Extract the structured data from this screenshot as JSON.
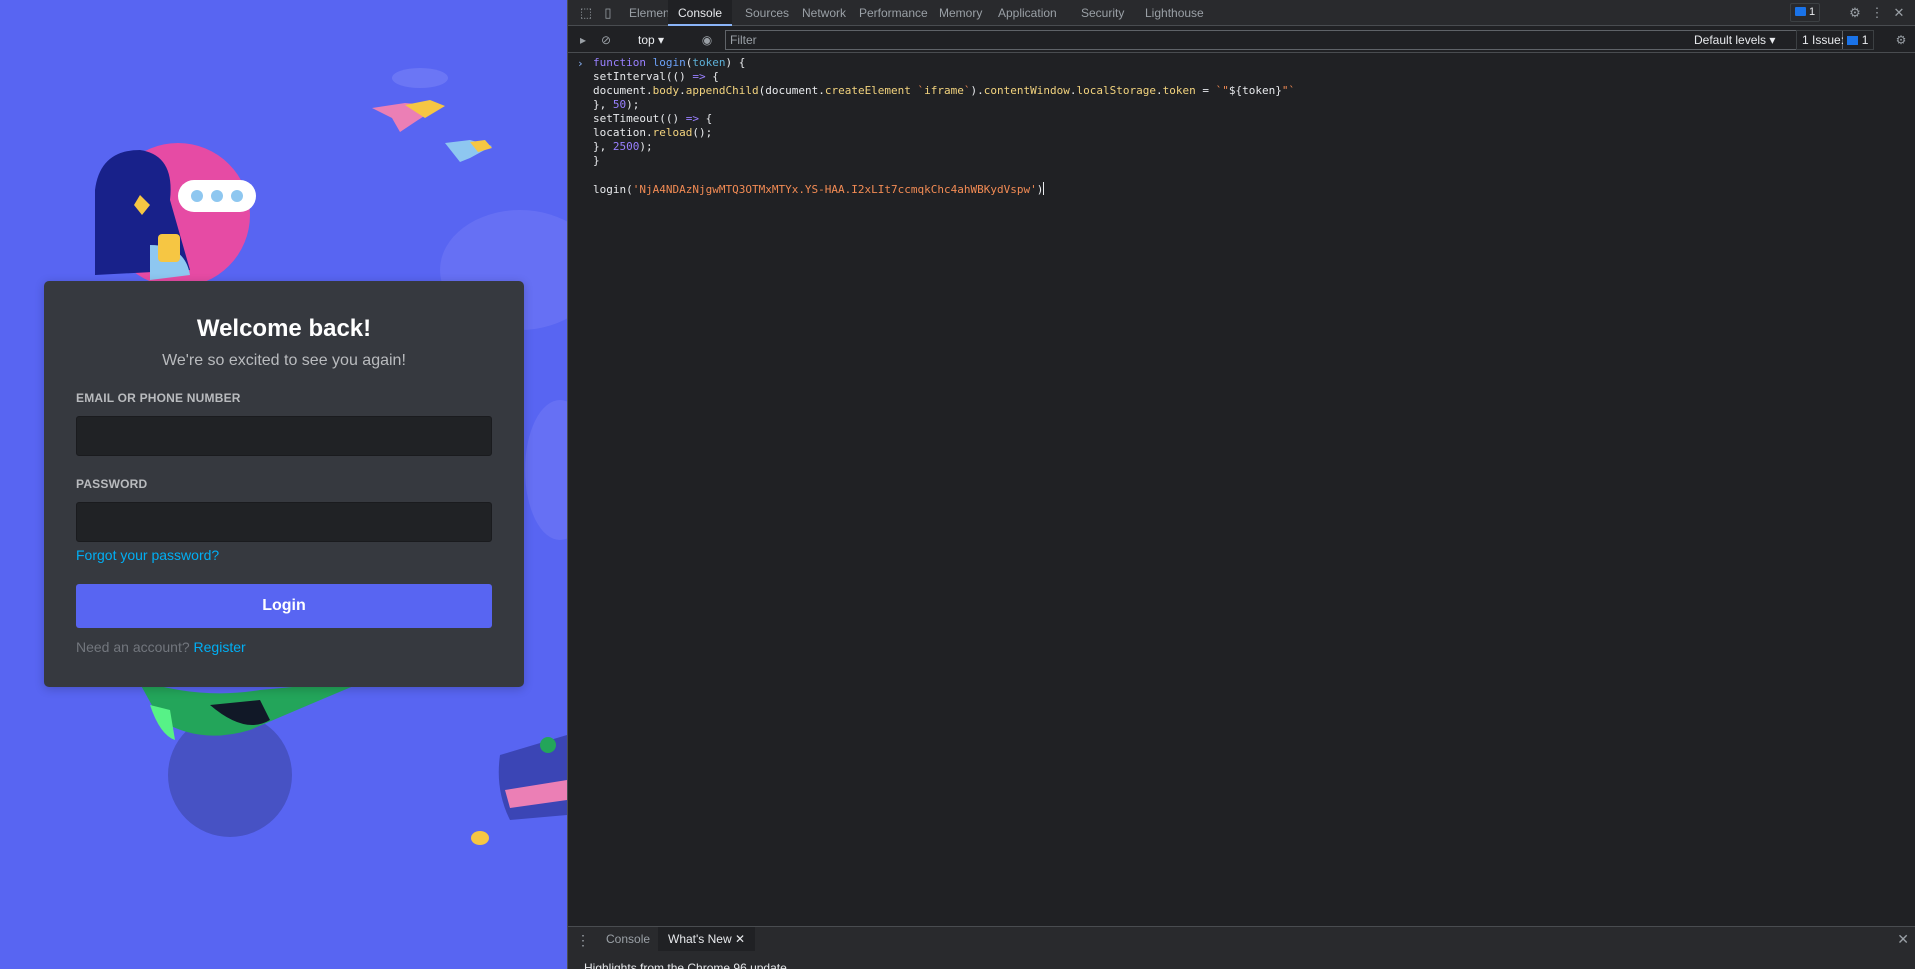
{
  "login": {
    "title": "Welcome back!",
    "subtitle": "We're so excited to see you again!",
    "email_label": "EMAIL OR PHONE NUMBER",
    "email_value": "",
    "password_label": "PASSWORD",
    "password_value": "",
    "forgot_link": "Forgot your password?",
    "login_button": "Login",
    "need_account": "Need an account?",
    "register_link": "Register",
    "colors": {
      "background": "#5865f2",
      "card": "#36393f",
      "button": "#5865f2",
      "link": "#00aff4"
    }
  },
  "devtools": {
    "tabs": [
      "Elements",
      "Console",
      "Sources",
      "Network",
      "Performance",
      "Memory",
      "Application",
      "Security",
      "Lighthouse"
    ],
    "active_tab": "Console",
    "message_badge": "1",
    "toolbar": {
      "context": "top",
      "filter_placeholder": "Filter",
      "levels": "Default levels",
      "issues_label": "1 Issue:",
      "issues_count": "1"
    },
    "console": {
      "code": {
        "l1_kw": "function",
        "l1_fn": "login",
        "l1_param": "token",
        "l2_fn": "setInterval",
        "l3_a": "document",
        "l3_b": "body",
        "l3_c": "appendChild",
        "l3_d": "document",
        "l3_e": "createElement",
        "l3_f": "iframe",
        "l3_g": "contentWindow",
        "l3_h": "localStorage",
        "l3_i": "token",
        "l3_j": "${token}",
        "l4_num": "50",
        "l5_fn": "setTimeout",
        "l6_a": "location",
        "l6_b": "reload",
        "l7_num": "2500",
        "l9_fn": "login",
        "l9_str": "'NjA4NDAzNjgwMTQ3OTMxMTYx.YS-HAA.I2xLIt7ccmqkChc4ahWBKydVspw'"
      }
    },
    "drawer": {
      "tabs": [
        "Console",
        "What's New"
      ],
      "active_tab": "What's New",
      "panel_text": "Highlights from the Chrome 96 update"
    }
  }
}
